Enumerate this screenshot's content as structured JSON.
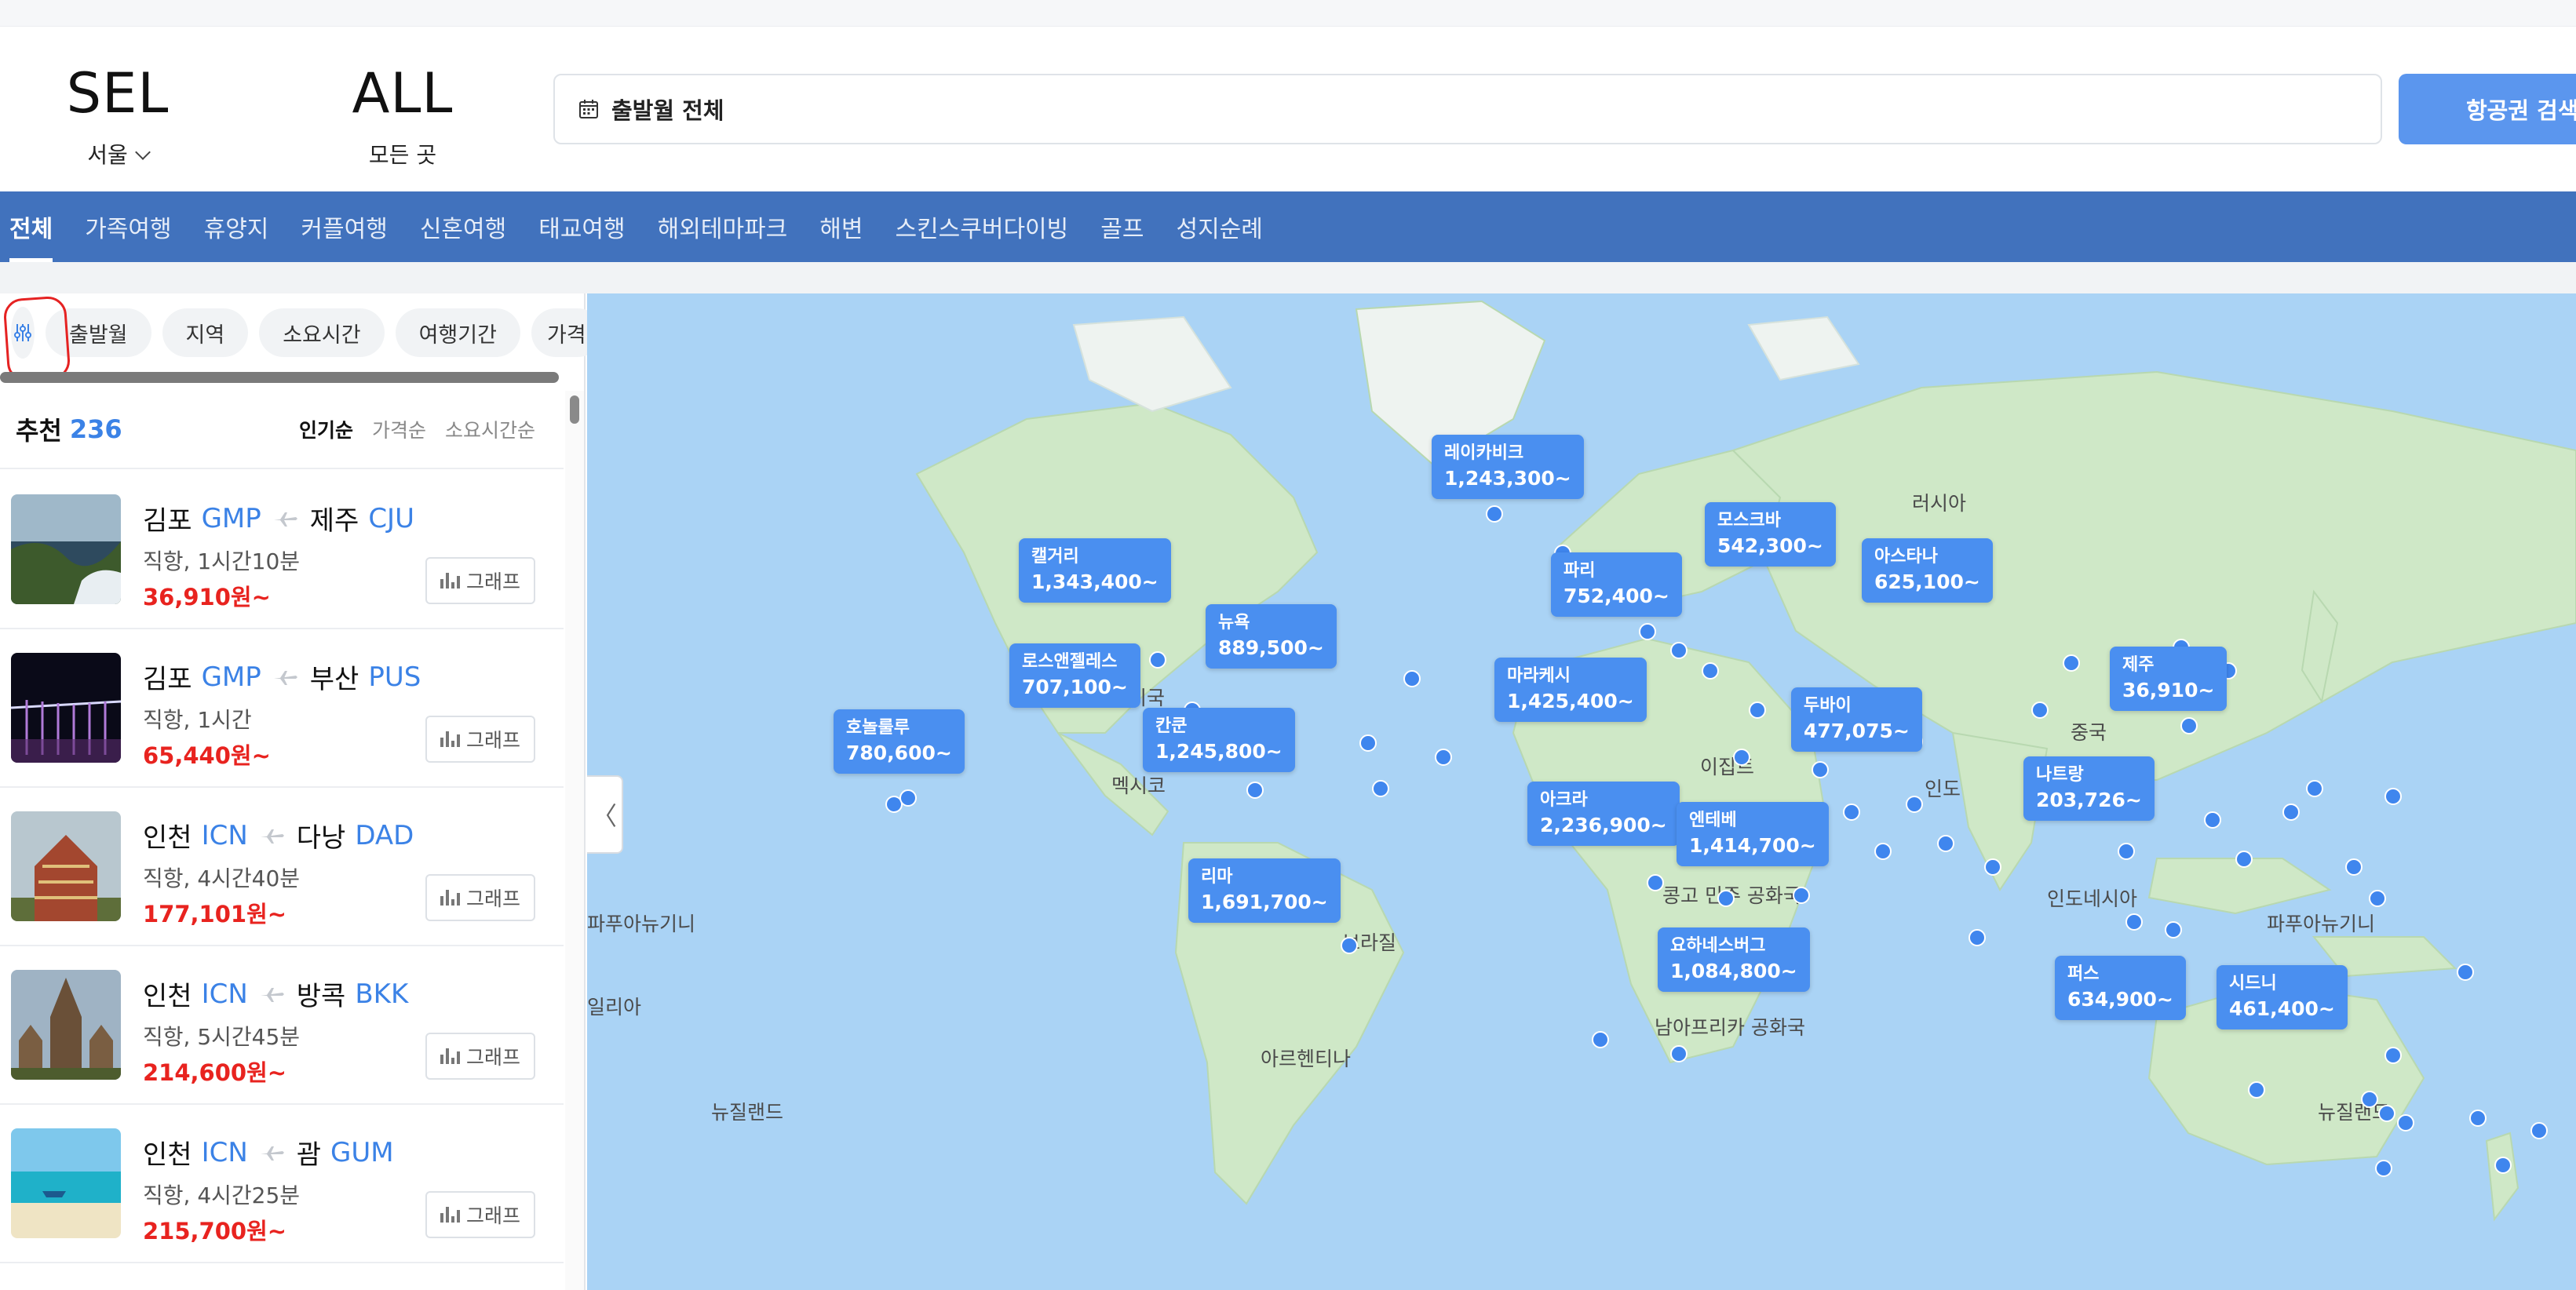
{
  "header": {
    "origin": {
      "code": "SEL",
      "city": "서울"
    },
    "destination": {
      "code": "ALL",
      "city": "모든 곳"
    },
    "date_field": "출발월 전체",
    "search_button": "항공권 검색"
  },
  "categories": [
    "전체",
    "가족여행",
    "휴양지",
    "커플여행",
    "신혼여행",
    "태교여행",
    "해외테마파크",
    "해변",
    "스킨스쿠버다이빙",
    "골프",
    "성지순례"
  ],
  "filters": [
    "출발월",
    "지역",
    "소요시간",
    "여행기간",
    "가격"
  ],
  "list": {
    "title": "추천",
    "count": "236",
    "sorts": [
      "인기순",
      "가격순",
      "소요시간순"
    ]
  },
  "flights": [
    {
      "from_city": "김포",
      "from_code": "GMP",
      "to_city": "제주",
      "to_code": "CJU",
      "duration": "직항, 1시간10분",
      "price": "36,910원~",
      "graph": "그래프"
    },
    {
      "from_city": "김포",
      "from_code": "GMP",
      "to_city": "부산",
      "to_code": "PUS",
      "duration": "직항, 1시간",
      "price": "65,440원~",
      "graph": "그래프"
    },
    {
      "from_city": "인천",
      "from_code": "ICN",
      "to_city": "다낭",
      "to_code": "DAD",
      "duration": "직항, 4시간40분",
      "price": "177,101원~",
      "graph": "그래프"
    },
    {
      "from_city": "인천",
      "from_code": "ICN",
      "to_city": "방콕",
      "to_code": "BKK",
      "duration": "직항, 5시간45분",
      "price": "214,600원~",
      "graph": "그래프"
    },
    {
      "from_city": "인천",
      "from_code": "ICN",
      "to_city": "괌",
      "to_code": "GUM",
      "duration": "직항, 4시간25분",
      "price": "215,700원~",
      "graph": "그래프"
    }
  ],
  "map": {
    "collapse_glyph": "〈",
    "pins": [
      {
        "name": "레이카비크",
        "price": "1,243,300~"
      },
      {
        "name": "캘거리",
        "price": "1,343,400~"
      },
      {
        "name": "뉴욕",
        "price": "889,500~"
      },
      {
        "name": "로스앤젤레스",
        "price": "707,100~"
      },
      {
        "name": "호놀룰루",
        "price": "780,600~"
      },
      {
        "name": "칸쿤",
        "price": "1,245,800~"
      },
      {
        "name": "리마",
        "price": "1,691,700~"
      },
      {
        "name": "모스크바",
        "price": "542,300~"
      },
      {
        "name": "파리",
        "price": "752,400~"
      },
      {
        "name": "아스타나",
        "price": "625,100~"
      },
      {
        "name": "마라케시",
        "price": "1,425,400~"
      },
      {
        "name": "두바이",
        "price": "477,075~"
      },
      {
        "name": "제주",
        "price": "36,910~"
      },
      {
        "name": "나트랑",
        "price": "203,726~"
      },
      {
        "name": "아크라",
        "price": "2,236,900~"
      },
      {
        "name": "엔테베",
        "price": "1,414,700~"
      },
      {
        "name": "요하네스버그",
        "price": "1,084,800~"
      },
      {
        "name": "퍼스",
        "price": "634,900~"
      },
      {
        "name": "시드니",
        "price": "461,400~"
      }
    ],
    "labels": [
      "러시아",
      "중국",
      "인도",
      "이집트",
      "미국",
      "멕시코",
      "브라질",
      "아르헨티나",
      "뉴질랜드",
      "파푸아뉴기니",
      "인도네시아",
      "남아프리카 공화국",
      "콩고 민주 공화국",
      "파푸아뉴기니",
      "일리아",
      "뉴질랜드"
    ]
  }
}
